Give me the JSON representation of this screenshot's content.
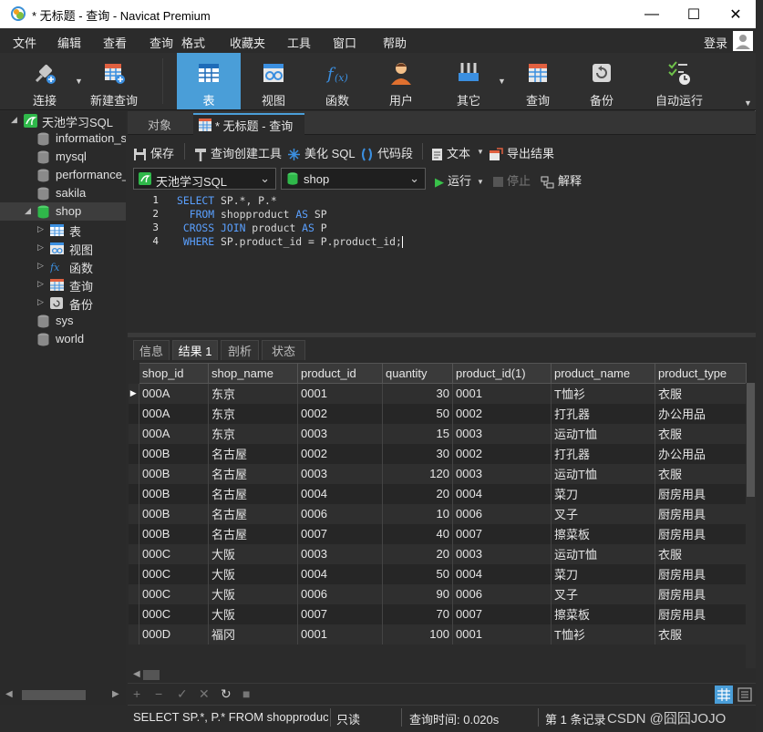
{
  "window": {
    "title": "* 无标题 - 查询 - Navicat Premium",
    "buttons": {
      "minimize": "—",
      "maximize": "☐",
      "close": "✕"
    }
  },
  "menu": {
    "items": [
      "文件",
      "编辑",
      "查看",
      "查询",
      "格式",
      "收藏夹",
      "工具",
      "窗口",
      "帮助"
    ],
    "login": "登录"
  },
  "toolbar": {
    "items": [
      {
        "label": "连接",
        "icon": "plug-icon"
      },
      {
        "label": "新建查询",
        "icon": "new-query-icon"
      },
      {
        "label": "表",
        "icon": "table-icon"
      },
      {
        "label": "视图",
        "icon": "view-icon"
      },
      {
        "label": "函数",
        "icon": "function-icon"
      },
      {
        "label": "用户",
        "icon": "user-icon"
      },
      {
        "label": "其它",
        "icon": "tools-icon"
      },
      {
        "label": "查询",
        "icon": "query-icon"
      },
      {
        "label": "备份",
        "icon": "backup-icon"
      },
      {
        "label": "自动运行",
        "icon": "automation-icon"
      }
    ]
  },
  "sidebar": {
    "connection": "天池学习SQL",
    "databases": [
      "information_s",
      "mysql",
      "performance_",
      "sakila",
      "shop",
      "sys",
      "world"
    ],
    "shop_children": [
      "表",
      "视图",
      "函数",
      "查询",
      "备份"
    ]
  },
  "tabs": {
    "objects": "对象",
    "query_tab": "* 无标题 - 查询"
  },
  "query_toolbar": {
    "save": "保存",
    "builder": "查询创建工具",
    "beautify": "美化 SQL",
    "snippet": "代码段",
    "text": "文本",
    "export": "导出结果"
  },
  "selectors": {
    "connection": "天池学习SQL",
    "database": "shop",
    "run": "运行",
    "stop": "停止",
    "explain": "解释"
  },
  "editor": {
    "line_numbers": [
      "1",
      "2",
      "3",
      "4"
    ],
    "lines": [
      [
        {
          "kw": true,
          "t": "SELECT"
        },
        {
          "kw": false,
          "t": " SP.*, P.*"
        }
      ],
      [
        {
          "kw": false,
          "t": "  "
        },
        {
          "kw": true,
          "t": "FROM"
        },
        {
          "kw": false,
          "t": " shopproduct "
        },
        {
          "kw": true,
          "t": "AS"
        },
        {
          "kw": false,
          "t": " SP"
        }
      ],
      [
        {
          "kw": false,
          "t": " "
        },
        {
          "kw": true,
          "t": "CROSS JOIN"
        },
        {
          "kw": false,
          "t": " product "
        },
        {
          "kw": true,
          "t": "AS"
        },
        {
          "kw": false,
          "t": " P"
        }
      ],
      [
        {
          "kw": false,
          "t": " "
        },
        {
          "kw": true,
          "t": "WHERE"
        },
        {
          "kw": false,
          "t": " SP.product_id = P.product_id;"
        }
      ]
    ]
  },
  "result_tabs": [
    "信息",
    "结果 1",
    "剖析",
    "状态"
  ],
  "grid": {
    "columns": [
      "shop_id",
      "shop_name",
      "product_id",
      "quantity",
      "product_id(1)",
      "product_name",
      "product_type"
    ],
    "rows": [
      [
        "000A",
        "东京",
        "0001",
        "30",
        "0001",
        "T恤衫",
        "衣服"
      ],
      [
        "000A",
        "东京",
        "0002",
        "50",
        "0002",
        "打孔器",
        "办公用品"
      ],
      [
        "000A",
        "东京",
        "0003",
        "15",
        "0003",
        "运动T恤",
        "衣服"
      ],
      [
        "000B",
        "名古屋",
        "0002",
        "30",
        "0002",
        "打孔器",
        "办公用品"
      ],
      [
        "000B",
        "名古屋",
        "0003",
        "120",
        "0003",
        "运动T恤",
        "衣服"
      ],
      [
        "000B",
        "名古屋",
        "0004",
        "20",
        "0004",
        "菜刀",
        "厨房用具"
      ],
      [
        "000B",
        "名古屋",
        "0006",
        "10",
        "0006",
        "叉子",
        "厨房用具"
      ],
      [
        "000B",
        "名古屋",
        "0007",
        "40",
        "0007",
        "擦菜板",
        "厨房用具"
      ],
      [
        "000C",
        "大阪",
        "0003",
        "20",
        "0003",
        "运动T恤",
        "衣服"
      ],
      [
        "000C",
        "大阪",
        "0004",
        "50",
        "0004",
        "菜刀",
        "厨房用具"
      ],
      [
        "000C",
        "大阪",
        "0006",
        "90",
        "0006",
        "叉子",
        "厨房用具"
      ],
      [
        "000C",
        "大阪",
        "0007",
        "70",
        "0007",
        "擦菜板",
        "厨房用具"
      ],
      [
        "000D",
        "福冈",
        "0001",
        "100",
        "0001",
        "T恤衫",
        "衣服"
      ]
    ]
  },
  "status": {
    "sql": "SELECT SP.*, P.*   FROM shopproduct",
    "readonly": "只读",
    "query_time": "查询时间: 0.020s",
    "record": "第 1 条记录",
    "watermark": "CSDN @囧囧JOJO"
  }
}
